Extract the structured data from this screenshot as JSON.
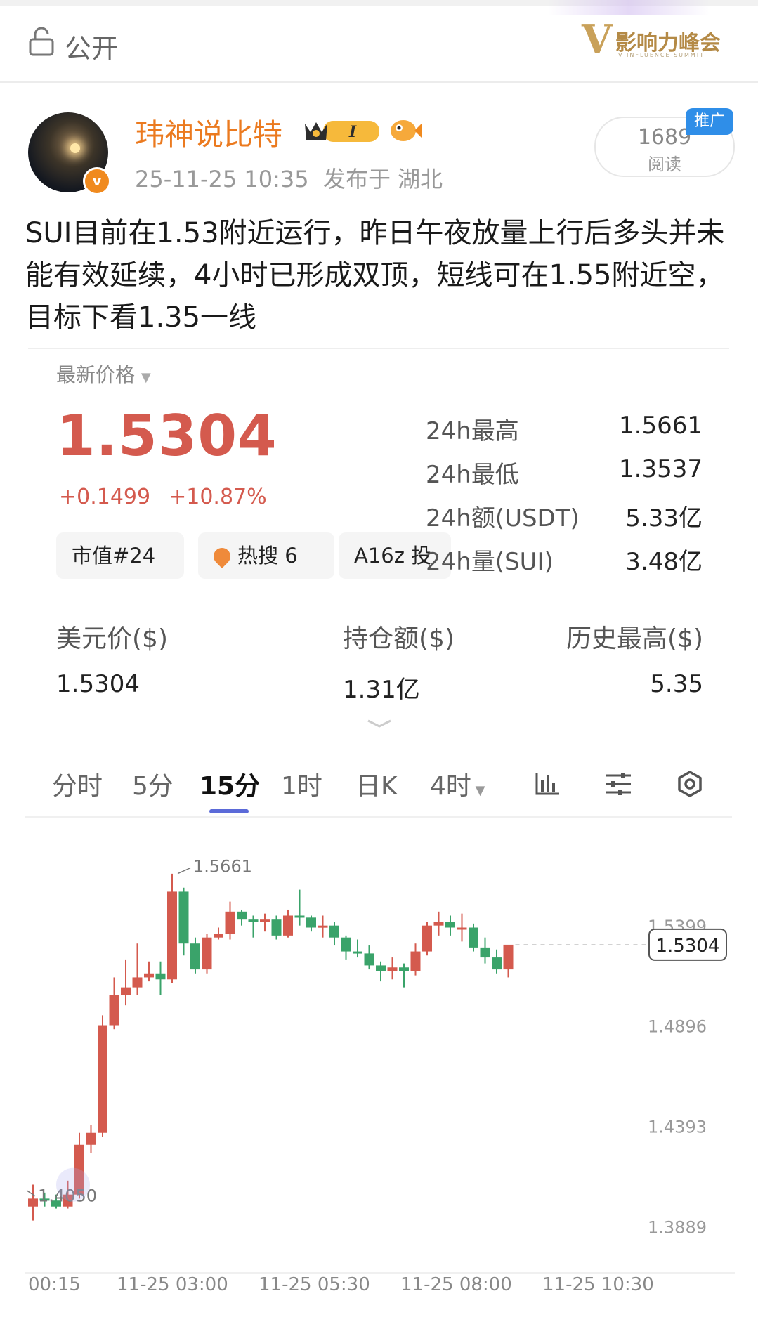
{
  "header": {
    "visibility_label": "公开",
    "brand_name": "影响力峰会",
    "brand_subtitle": "V INFLUENCE SUMMIT"
  },
  "author": {
    "name": "玮神说比特",
    "badge_text": "I",
    "verified_mark": "v",
    "timestamp": "25-11-25 10:35",
    "location": "发布于 湖北"
  },
  "stats_box": {
    "reads": "1689",
    "reads_label": "阅读",
    "ad_tag": "推广"
  },
  "post": {
    "text": "SUI目前在1.53附近运行，昨日午夜放量上行后多头并未能有效延续，4小时已形成双顶，短线可在1.55附近空，目标下看1.35一线"
  },
  "market": {
    "latest_label": "最新价格",
    "price": "1.5304",
    "change_abs": "+0.1499",
    "change_pct": "+10.87%",
    "tags": [
      {
        "label": "市值#24"
      },
      {
        "label": "热搜 6"
      },
      {
        "label": "A16z 投"
      }
    ],
    "stats": [
      {
        "key": "24h最高",
        "value": "1.5661"
      },
      {
        "key": "24h最低",
        "value": "1.3537"
      },
      {
        "key": "24h额(USDT)",
        "value": "5.33亿"
      },
      {
        "key": "24h量(SUI)",
        "value": "3.48亿"
      }
    ],
    "usd_label": "美元价($)",
    "usd_value": "1.5304",
    "oi_label": "持仓额($)",
    "oi_value": "1.31亿",
    "ath_label": "历史最高($)",
    "ath_value": "5.35"
  },
  "tabs": [
    {
      "label": "分时"
    },
    {
      "label": "5分"
    },
    {
      "label": "15分"
    },
    {
      "label": "1时"
    },
    {
      "label": "日K"
    },
    {
      "label": "4时"
    }
  ],
  "active_tab": "15分",
  "colors": {
    "up": "#d45a4e",
    "down": "#3aa36a",
    "accent": "#5b6ad8",
    "name": "#eb7a1f"
  },
  "chart_data": {
    "type": "candlestick",
    "ylim": [
      1.37,
      1.585
    ],
    "y_ticks": [
      "1.5399",
      "1.4896",
      "1.4393",
      "1.3889"
    ],
    "y_tick_values": [
      1.5399,
      1.4896,
      1.4393,
      1.3889
    ],
    "x_ticks": [
      "00:15",
      "11-25 03:00",
      "11-25 05:30",
      "11-25 08:00",
      "11-25 10:30"
    ],
    "x_tick_index": [
      0,
      11,
      21,
      31,
      41
    ],
    "current_price": "1.5304",
    "high_marker": "1.5661",
    "low_marker": "1.4050",
    "candles": [
      [
        1.399,
        1.403,
        1.41,
        1.392
      ],
      [
        1.403,
        1.402,
        1.406,
        1.399
      ],
      [
        1.402,
        1.399,
        1.405,
        1.398
      ],
      [
        1.399,
        1.405,
        1.412,
        1.398
      ],
      [
        1.405,
        1.43,
        1.436,
        1.403
      ],
      [
        1.43,
        1.436,
        1.44,
        1.426
      ],
      [
        1.436,
        1.49,
        1.495,
        1.434
      ],
      [
        1.49,
        1.505,
        1.514,
        1.488
      ],
      [
        1.505,
        1.509,
        1.523,
        1.5
      ],
      [
        1.509,
        1.514,
        1.531,
        1.505
      ],
      [
        1.514,
        1.516,
        1.522,
        1.512
      ],
      [
        1.516,
        1.513,
        1.522,
        1.505
      ],
      [
        1.513,
        1.557,
        1.566,
        1.511
      ],
      [
        1.557,
        1.531,
        1.559,
        1.525
      ],
      [
        1.531,
        1.518,
        1.534,
        1.516
      ],
      [
        1.518,
        1.534,
        1.536,
        1.516
      ],
      [
        1.534,
        1.536,
        1.539,
        1.533
      ],
      [
        1.536,
        1.547,
        1.552,
        1.533
      ],
      [
        1.547,
        1.543,
        1.548,
        1.54
      ],
      [
        1.543,
        1.542,
        1.545,
        1.534
      ],
      [
        1.542,
        1.543,
        1.546,
        1.537
      ],
      [
        1.543,
        1.535,
        1.545,
        1.533
      ],
      [
        1.535,
        1.545,
        1.548,
        1.534
      ],
      [
        1.545,
        1.544,
        1.558,
        1.54
      ],
      [
        1.544,
        1.539,
        1.545,
        1.537
      ],
      [
        1.539,
        1.54,
        1.545,
        1.534
      ],
      [
        1.54,
        1.534,
        1.542,
        1.53
      ],
      [
        1.534,
        1.527,
        1.535,
        1.523
      ],
      [
        1.527,
        1.526,
        1.533,
        1.524
      ],
      [
        1.526,
        1.52,
        1.53,
        1.518
      ],
      [
        1.52,
        1.517,
        1.522,
        1.512
      ],
      [
        1.517,
        1.519,
        1.524,
        1.513
      ],
      [
        1.519,
        1.517,
        1.521,
        1.509
      ],
      [
        1.517,
        1.527,
        1.531,
        1.515
      ],
      [
        1.527,
        1.54,
        1.542,
        1.525
      ],
      [
        1.54,
        1.542,
        1.547,
        1.535
      ],
      [
        1.542,
        1.539,
        1.545,
        1.535
      ],
      [
        1.539,
        1.539,
        1.546,
        1.532
      ],
      [
        1.539,
        1.529,
        1.541,
        1.527
      ],
      [
        1.529,
        1.524,
        1.534,
        1.521
      ],
      [
        1.524,
        1.518,
        1.528,
        1.516
      ],
      [
        1.518,
        1.5304,
        1.524,
        1.514
      ]
    ]
  }
}
